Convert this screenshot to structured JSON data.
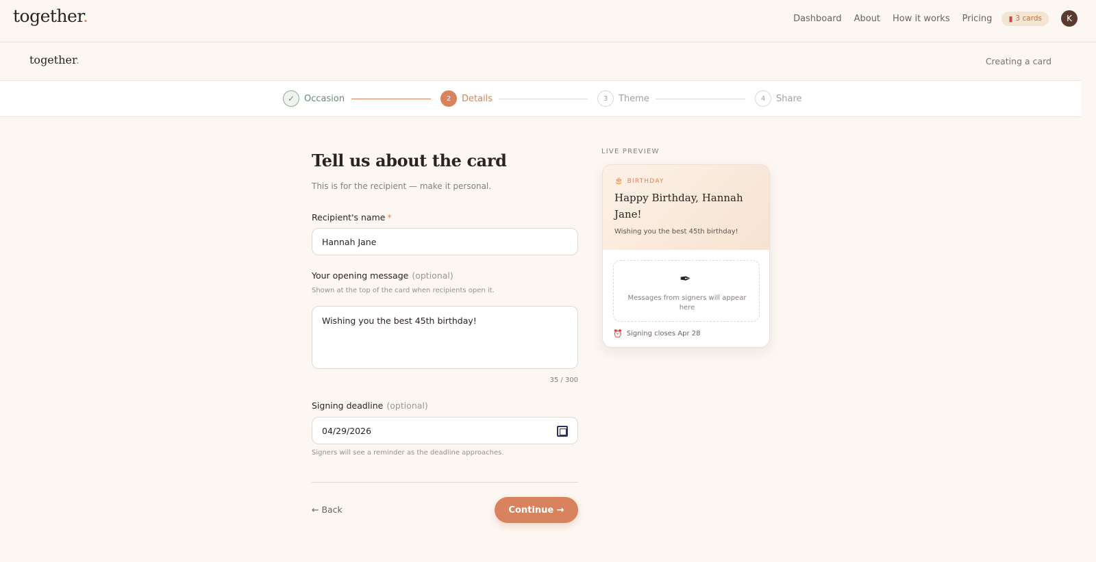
{
  "nav": {
    "brand": "together",
    "brand_dot": ".",
    "links": [
      "Dashboard",
      "About",
      "How it works",
      "Pricing"
    ],
    "cards_badge": "3 cards",
    "avatar_initial": "K"
  },
  "subheader": {
    "brand": "together",
    "brand_dot": ".",
    "status": "Creating a card"
  },
  "stepper": {
    "steps": [
      {
        "number": "✓",
        "label": "Occasion",
        "state": "done"
      },
      {
        "number": "2",
        "label": "Details",
        "state": "active"
      },
      {
        "number": "3",
        "label": "Theme",
        "state": "upcoming"
      },
      {
        "number": "4",
        "label": "Share",
        "state": "upcoming"
      }
    ]
  },
  "form": {
    "title": "Tell us about the card",
    "subtitle": "This is for the recipient — make it personal.",
    "recipient": {
      "label": "Recipient's name",
      "required_mark": "*",
      "value": "Hannah Jane"
    },
    "opening_message": {
      "label": "Your opening message",
      "optional": "(optional)",
      "hint": "Shown at the top of the card when recipients open it.",
      "value": "Wishing you the best 45th birthday!",
      "counter": "35 / 300"
    },
    "deadline": {
      "label": "Signing deadline",
      "optional": "(optional)",
      "value": "04/29/2026",
      "hint": "Signers will see a reminder as the deadline approaches."
    },
    "back_label": "← Back",
    "continue_label": "Continue →"
  },
  "preview": {
    "section_label": "LIVE PREVIEW",
    "occasion_icon": "cake-icon",
    "occasion": "BIRTHDAY",
    "title": "Happy Birthday, Hannah Jane!",
    "message": "Wishing you the best 45th birthday!",
    "empty_icon": "feather-icon",
    "empty_text": "Messages from signers will appear here",
    "deadline_icon": "alarm-clock-icon",
    "deadline": "Signing closes Apr 28"
  },
  "colors": {
    "accent": "#d9825e",
    "background": "#fcf7f2",
    "success": "#6a8c6e"
  }
}
